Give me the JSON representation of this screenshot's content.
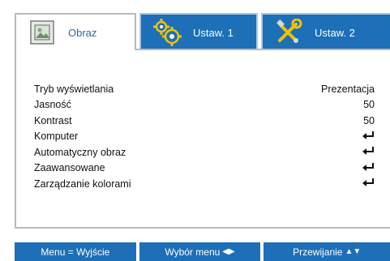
{
  "tabs": [
    {
      "label": "Obraz",
      "icon": "image-icon",
      "active": true
    },
    {
      "label": "Ustaw. 1",
      "icon": "gears-icon",
      "active": false
    },
    {
      "label": "Ustaw. 2",
      "icon": "tools-icon",
      "active": false
    }
  ],
  "menu": [
    {
      "label": "Tryb wyświetlania",
      "value": "Prezentacja"
    },
    {
      "label": "Jasność",
      "value": "50"
    },
    {
      "label": "Kontrast",
      "value": "50"
    },
    {
      "label": "Komputer",
      "value": "",
      "icon": "enter-icon"
    },
    {
      "label": "Automatyczny obraz",
      "value": "",
      "icon": "enter-icon"
    },
    {
      "label": "Zaawansowane",
      "value": "",
      "icon": "enter-icon"
    },
    {
      "label": "Zarządzanie kolorami",
      "value": "",
      "icon": "enter-icon"
    }
  ],
  "footer": {
    "exit": "Menu = Wyjście",
    "select": "Wybór menu",
    "select_arrows": "◀▶",
    "scroll": "Przewijanie",
    "scroll_arrows": "▲▼"
  },
  "colors": {
    "accent": "#1d6fb7",
    "active_tab_text": "#2b6aa6",
    "border": "#b9b9b9"
  }
}
